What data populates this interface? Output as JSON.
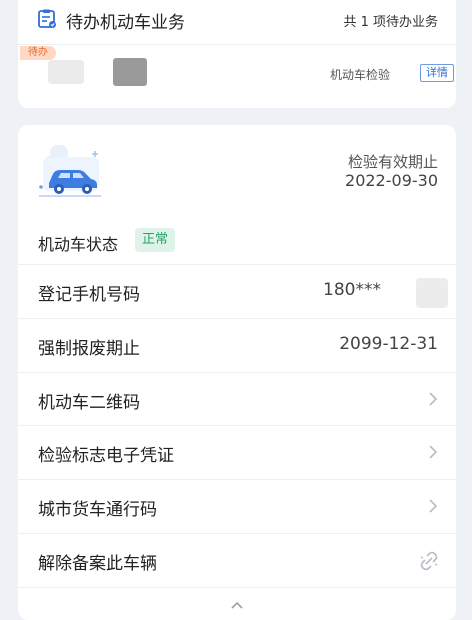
{
  "pending": {
    "title": "待办机动车业务",
    "count_text": "共 1 项待办业务",
    "badge": "待办",
    "item_type": "机动车检验",
    "detail_label": "详情"
  },
  "vehicle": {
    "validity_label": "检验有效期止",
    "validity_date": "2022-09-30",
    "status_label": "机动车状态",
    "status_value": "正常",
    "rows": [
      {
        "label": "登记手机号码",
        "value": "180***"
      },
      {
        "label": "强制报废期止",
        "value": "2099-12-31"
      },
      {
        "label": "机动车二维码"
      },
      {
        "label": "检验标志电子凭证"
      },
      {
        "label": "城市货车通行码"
      },
      {
        "label": "解除备案此车辆"
      }
    ]
  },
  "icons": [
    "document-icon",
    "car-icon",
    "chevron-right-icon",
    "unlink-icon",
    "chevron-up-icon"
  ],
  "colors": {
    "accent_blue": "#2f6fd6",
    "status_green": "#29a06a",
    "pending_orange": "#e46c2f",
    "background": "#eef1f6"
  }
}
